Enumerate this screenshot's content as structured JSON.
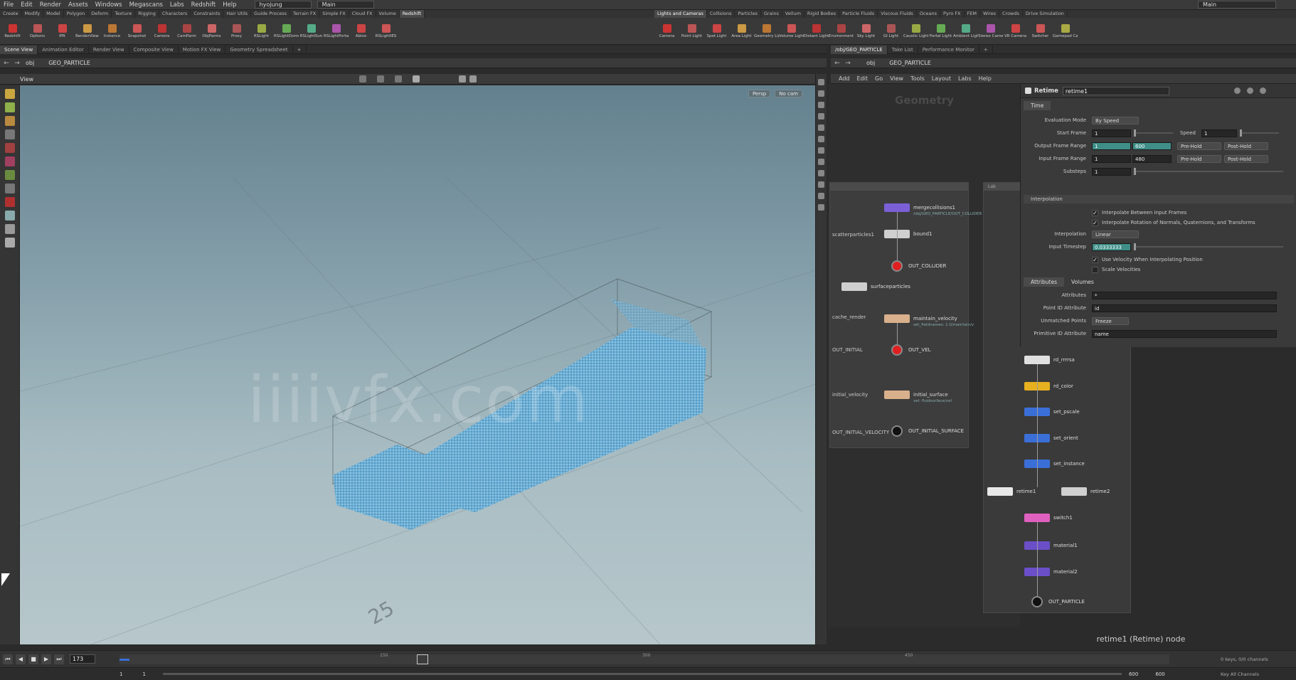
{
  "menubar": {
    "items": [
      "File",
      "Edit",
      "Render",
      "Assets",
      "Windows",
      "Megascans",
      "Labs",
      "Redshift",
      "Help"
    ],
    "desktop": "hyojung",
    "layout": "Main",
    "right_layout": "Main"
  },
  "shelf_left": {
    "tabs": [
      "Create",
      "Modify",
      "Model",
      "Polygon",
      "Deform",
      "Texture",
      "Rigging",
      "Characters",
      "Constraints",
      "Hair Utils",
      "Guide Process",
      "Terrain FX",
      "Simple FX",
      "Cloud FX",
      "Volume",
      "Redshift"
    ],
    "active_tab": "Redshift",
    "tools": [
      "Redshift",
      "Options",
      "IPR",
      "RenderView",
      "Instance",
      "Snapshot",
      "Camera",
      "CamParm",
      "ObjParms",
      "Proxy",
      "RSLight",
      "RSLightDome",
      "RSLightSun",
      "RSLightPortal",
      "Abloo",
      "RSLightIES"
    ]
  },
  "shelf_right": {
    "tabs": [
      "Lights and Cameras",
      "Collisions",
      "Particles",
      "Grains",
      "Vellum",
      "Rigid Bodies",
      "Particle Fluids",
      "Viscous Fluids",
      "Oceans",
      "Pyro FX",
      "FEM",
      "Wires",
      "Crowds",
      "Drive Simulation"
    ],
    "active_tab": "Lights and Cameras",
    "tools": [
      "Camera",
      "Point Light",
      "Spot Light",
      "Area Light",
      "Geometry Light",
      "Volume Light",
      "Distant Light",
      "Environment Light",
      "Sky Light",
      "GI Light",
      "Caustic Light",
      "Portal Light",
      "Ambient Light",
      "Stereo Camera",
      "VR Camera",
      "Switcher",
      "Gamepad Camera"
    ]
  },
  "left_panes": {
    "tabs": [
      "Scene View",
      "Animation Editor",
      "Render View",
      "Composite View",
      "Motion FX View",
      "Geometry Spreadsheet"
    ],
    "path": [
      "obj",
      "GEO_PARTICLE"
    ],
    "viewport_label": "View",
    "persp_btn": "Persp",
    "cam_btn": "No cam"
  },
  "right_panes": {
    "tabs": [
      "/obj/GEO_PARTICLE",
      "Take List",
      "Performance Monitor"
    ],
    "path": [
      "obj",
      "GEO_PARTICLE"
    ],
    "menu": [
      "Add",
      "Edit",
      "Go",
      "View",
      "Tools",
      "Layout",
      "Labs",
      "Help"
    ],
    "context_label": "Geometry"
  },
  "viewport": {
    "watermark": "iiiivfx.com",
    "grid_number": "25"
  },
  "network": {
    "box1_nodes": [
      {
        "label": "mergecollisions1",
        "sub": "/obj/GEO_PARTICLE/OUT_COLLIDER",
        "color": "#7b5fd6"
      },
      {
        "label": "bound1",
        "sub": "",
        "color": "#cfcfcf"
      },
      {
        "label": "maintain_velocity",
        "sub": "set_fieldnames: 1.0/maintain/v",
        "color": "#d9b08c"
      },
      {
        "label": "initial_surface",
        "sub": "vel: fluidsurface/vel",
        "color": "#d9b08c"
      },
      {
        "label": "surfaceparticles",
        "sub": "",
        "color": "#cfcfcf"
      }
    ],
    "box1_outputs": [
      {
        "label": "OUT_COLLIDER",
        "color": "#e02020"
      },
      {
        "label": "OUT_VEL",
        "color": "#e02020"
      },
      {
        "label": "OUT_INITIAL_SURFACE",
        "color": "#111111"
      }
    ],
    "box1_left_labels": [
      "scatterparticles1",
      "cache_render",
      "OUT_INITIAL",
      "initial_velocity",
      "OUT_INITIAL_VELOCITY"
    ],
    "box2_nodes": [
      {
        "label": "rd_rrrrsa",
        "color": "#e0e0e0"
      },
      {
        "label": "rd_color",
        "color": "#e6b020"
      },
      {
        "label": "set_pscale",
        "color": "#3a6fd8"
      },
      {
        "label": "set_orient",
        "color": "#3a6fd8"
      },
      {
        "label": "set_instance",
        "color": "#3a6fd8"
      },
      {
        "label": "retime1",
        "color": "#e8e8e8"
      },
      {
        "label": "retime2",
        "color": "#cfcfcf"
      },
      {
        "label": "switch1",
        "color": "#e060c0"
      },
      {
        "label": "material1",
        "color": "#6a4fc8"
      },
      {
        "label": "material2",
        "color": "#6a4fc8"
      }
    ],
    "box2_output": "OUT_PARTICLE",
    "caption": "retime1 (Retime) node"
  },
  "params": {
    "node_type": "Retime",
    "node_name": "retime1",
    "tab_time": "Time",
    "eval_mode_label": "Evaluation Mode",
    "eval_mode": "By Speed",
    "start_frame_label": "Start Frame",
    "start_frame": "1",
    "speed_label": "Speed",
    "speed": "1",
    "output_range_label": "Output Frame Range",
    "output_range": [
      "1",
      "600"
    ],
    "input_range_label": "Input Frame Range",
    "input_range": [
      "1",
      "480"
    ],
    "pre_hold": "Pre-Hold",
    "post_hold": "Post-Hold",
    "substeps_label": "Substeps",
    "substeps": "1",
    "interp_section": "Interpolation",
    "interp_between": "Interpolate Between Input Frames",
    "interp_rotation": "Interpolate Rotation of Normals, Quaternions, and Transforms",
    "interp_label": "Interpolation",
    "interp_value": "Linear",
    "input_timestep_label": "Input Timestep",
    "input_timestep": "0.0333333",
    "use_velocity": "Use Velocity When Interpolating Position",
    "scale_velocities": "Scale Velocities",
    "sub_tabs": [
      "Attributes",
      "Volumes"
    ],
    "attributes_label": "Attributes",
    "attributes_value": "*",
    "point_id_label": "Point ID Attribute",
    "point_id_value": "id",
    "unmatched_label": "Unmatched Points",
    "unmatched_value": "Freeze",
    "prim_id_label": "Primitive ID Attribute",
    "prim_id_value": "name"
  },
  "timeline": {
    "current_frame": "173",
    "start": "1",
    "start2": "1",
    "end": "600",
    "end2": "600",
    "ticks": [
      "150",
      "300",
      "450"
    ],
    "keys_label": "0 keys, 0/0 channels",
    "all_channels": "Key All Channels"
  },
  "colors": {
    "accent_teal": "#3f8f88",
    "particles": "#6fb3d9",
    "viewport_sky": "#63808e"
  }
}
